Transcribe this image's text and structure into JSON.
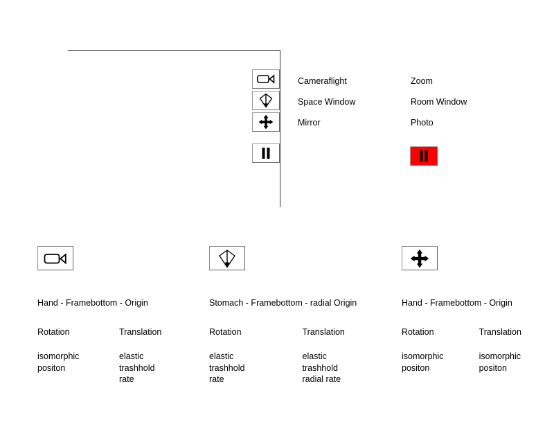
{
  "toolbar": {
    "buttons": [
      {
        "icon": "video-camera-icon",
        "name": "tool-cameraflight"
      },
      {
        "icon": "kite-diamond-icon",
        "name": "tool-space-window"
      },
      {
        "icon": "move-cross-icon",
        "name": "tool-mirror"
      },
      {
        "icon": "pause-icon",
        "name": "tool-pause"
      }
    ]
  },
  "labels": {
    "rows": [
      {
        "left": "Cameraflight",
        "right": "Zoom"
      },
      {
        "left": "Space Window",
        "right": "Room Window"
      },
      {
        "left": "Mirror",
        "right": "Photo"
      }
    ]
  },
  "status": {
    "pause_button_icon": "pause-icon",
    "pause_button_color": "#FE0000"
  },
  "panels": [
    {
      "icon": "video-camera-icon",
      "title": "Hand - Framebottom - Origin",
      "columns": [
        {
          "heading": "Rotation",
          "values": [
            "isomorphic",
            "positon"
          ]
        },
        {
          "heading": "Translation",
          "values": [
            "elastic",
            "trashhold",
            "rate"
          ]
        }
      ]
    },
    {
      "icon": "kite-diamond-icon",
      "title": "Stomach - Framebottom - radial Origin",
      "columns": [
        {
          "heading": "Rotation",
          "values": [
            "elastic",
            "trashhold",
            "rate"
          ]
        },
        {
          "heading": "Translation",
          "values": [
            "elastic",
            "trashhold",
            "radial rate"
          ]
        }
      ]
    },
    {
      "icon": "move-cross-icon",
      "title": "Hand - Framebottom - Origin",
      "columns": [
        {
          "heading": "Rotation",
          "values": [
            "isomorphic",
            "positon"
          ]
        },
        {
          "heading": "Translation",
          "values": [
            "isomorphic",
            "positon"
          ]
        }
      ]
    }
  ]
}
